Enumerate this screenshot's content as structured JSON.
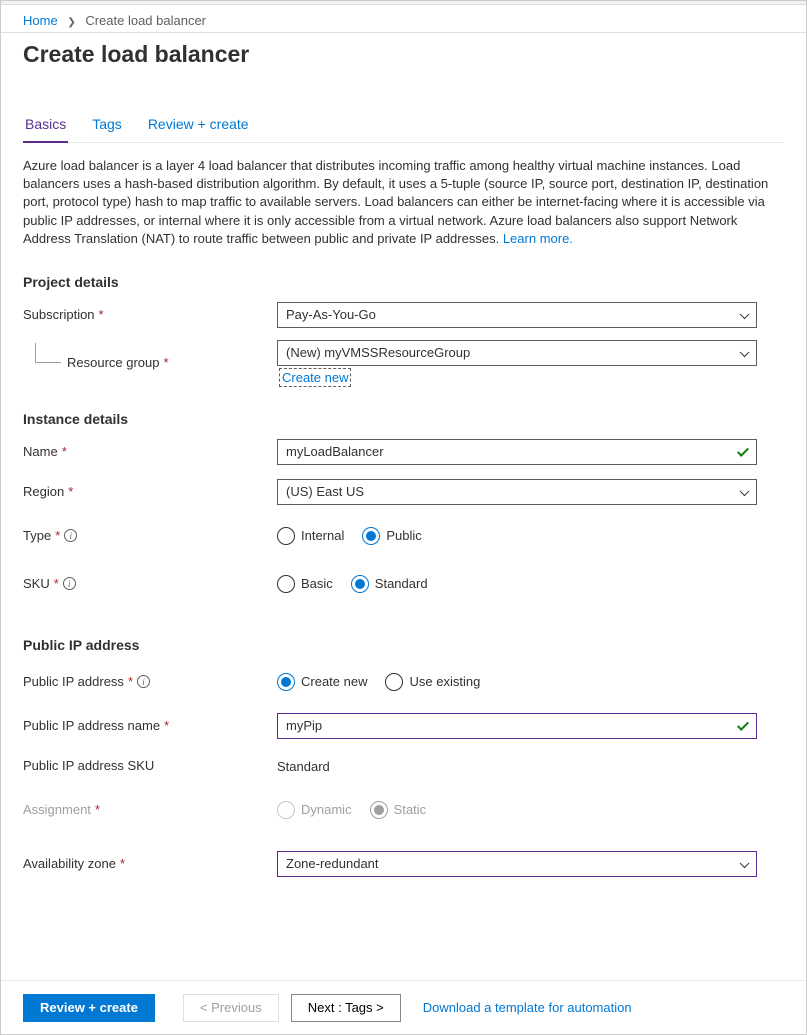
{
  "breadcrumb": {
    "home": "Home",
    "current": "Create load balancer"
  },
  "page_title": "Create load balancer",
  "tabs": {
    "basics": "Basics",
    "tags": "Tags",
    "review": "Review + create"
  },
  "description": "Azure load balancer is a layer 4 load balancer that distributes incoming traffic among healthy virtual machine instances. Load balancers uses a hash-based distribution algorithm. By default, it uses a 5-tuple (source IP, source port, destination IP, destination port, protocol type) hash to map traffic to available servers. Load balancers can either be internet-facing where it is accessible via public IP addresses, or internal where it is only accessible from a virtual network. Azure load balancers also support Network Address Translation (NAT) to route traffic between public and private IP addresses.",
  "learn_more": "Learn more.",
  "sections": {
    "project": "Project details",
    "instance": "Instance details",
    "public_ip": "Public IP address"
  },
  "labels": {
    "subscription": "Subscription",
    "resource_group": "Resource group",
    "create_new": "Create new",
    "name": "Name",
    "region": "Region",
    "type": "Type",
    "sku": "SKU",
    "public_ip": "Public IP address",
    "public_ip_name": "Public IP address name",
    "public_ip_sku": "Public IP address SKU",
    "assignment": "Assignment",
    "availability_zone": "Availability zone"
  },
  "values": {
    "subscription": "Pay-As-You-Go",
    "resource_group": "(New) myVMSSResourceGroup",
    "name": "myLoadBalancer",
    "region": "(US) East US",
    "public_ip_name": "myPip",
    "public_ip_sku": "Standard",
    "availability_zone": "Zone-redundant"
  },
  "radios": {
    "type": {
      "internal": "Internal",
      "public": "Public"
    },
    "sku": {
      "basic": "Basic",
      "standard": "Standard"
    },
    "public_ip": {
      "create_new": "Create new",
      "use_existing": "Use existing"
    },
    "assignment": {
      "dynamic": "Dynamic",
      "static": "Static"
    }
  },
  "footer": {
    "review": "Review + create",
    "previous": "< Previous",
    "next": "Next : Tags >",
    "download": "Download a template for automation"
  }
}
